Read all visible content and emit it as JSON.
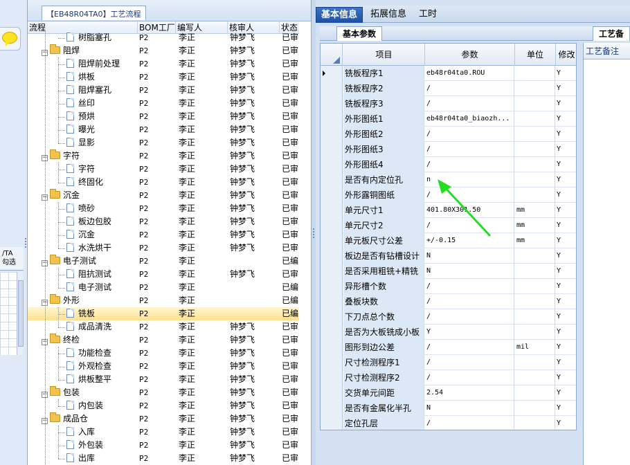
{
  "tree_panel": {
    "title": "【EB48R04TA0】工艺流程",
    "columns": [
      "流程",
      "BOM工厂",
      "编写人",
      "核审人",
      "状态"
    ],
    "rows": [
      {
        "type": "leaf",
        "name": "树脂塞孔",
        "bom": "P2",
        "writer": "李正",
        "reviewer": "钟梦飞",
        "status": "已审"
      },
      {
        "type": "group",
        "name": "阻焊",
        "bom": "P2",
        "writer": "李正",
        "reviewer": "钟梦飞",
        "status": "已审"
      },
      {
        "type": "leaf",
        "name": "阻焊前处理",
        "bom": "P2",
        "writer": "李正",
        "reviewer": "钟梦飞",
        "status": "已审"
      },
      {
        "type": "leaf",
        "name": "烘板",
        "bom": "P2",
        "writer": "李正",
        "reviewer": "钟梦飞",
        "status": "已审"
      },
      {
        "type": "leaf",
        "name": "阻焊塞孔",
        "bom": "P2",
        "writer": "李正",
        "reviewer": "钟梦飞",
        "status": "已审"
      },
      {
        "type": "leaf",
        "name": "丝印",
        "bom": "P2",
        "writer": "李正",
        "reviewer": "钟梦飞",
        "status": "已审"
      },
      {
        "type": "leaf",
        "name": "预烘",
        "bom": "P2",
        "writer": "李正",
        "reviewer": "钟梦飞",
        "status": "已审"
      },
      {
        "type": "leaf",
        "name": "曝光",
        "bom": "P2",
        "writer": "李正",
        "reviewer": "钟梦飞",
        "status": "已审"
      },
      {
        "type": "leaf",
        "name": "显影",
        "bom": "P2",
        "writer": "李正",
        "reviewer": "钟梦飞",
        "status": "已审"
      },
      {
        "type": "group",
        "name": "字符",
        "bom": "P2",
        "writer": "李正",
        "reviewer": "钟梦飞",
        "status": "已审"
      },
      {
        "type": "leaf",
        "name": "字符",
        "bom": "P2",
        "writer": "李正",
        "reviewer": "钟梦飞",
        "status": "已审"
      },
      {
        "type": "leaf",
        "name": "终固化",
        "bom": "P2",
        "writer": "李正",
        "reviewer": "钟梦飞",
        "status": "已审"
      },
      {
        "type": "group",
        "name": "沉金",
        "bom": "P2",
        "writer": "李正",
        "reviewer": "钟梦飞",
        "status": "已审"
      },
      {
        "type": "leaf",
        "name": "喷砂",
        "bom": "P2",
        "writer": "李正",
        "reviewer": "钟梦飞",
        "status": "已审"
      },
      {
        "type": "leaf",
        "name": "板边包胶",
        "bom": "P2",
        "writer": "李正",
        "reviewer": "钟梦飞",
        "status": "已审"
      },
      {
        "type": "leaf",
        "name": "沉金",
        "bom": "P2",
        "writer": "李正",
        "reviewer": "钟梦飞",
        "status": "已审"
      },
      {
        "type": "leaf",
        "name": "水洗烘干",
        "bom": "P2",
        "writer": "李正",
        "reviewer": "钟梦飞",
        "status": "已审"
      },
      {
        "type": "group",
        "name": "电子测试",
        "bom": "P2",
        "writer": "李正",
        "reviewer": "",
        "status": "已编"
      },
      {
        "type": "leaf",
        "name": "阻抗测试",
        "bom": "P2",
        "writer": "李正",
        "reviewer": "钟梦飞",
        "status": "已审"
      },
      {
        "type": "leaf",
        "name": "电子测试",
        "bom": "P2",
        "writer": "李正",
        "reviewer": "",
        "status": "已编"
      },
      {
        "type": "group",
        "name": "外形",
        "bom": "P2",
        "writer": "李正",
        "reviewer": "",
        "status": "已编"
      },
      {
        "type": "leaf",
        "name": "铣板",
        "bom": "P2",
        "writer": "李正",
        "reviewer": "",
        "status": "已编",
        "selected": true
      },
      {
        "type": "leaf",
        "name": "成品清洗",
        "bom": "P2",
        "writer": "李正",
        "reviewer": "钟梦飞",
        "status": "已审"
      },
      {
        "type": "group",
        "name": "终检",
        "bom": "P2",
        "writer": "李正",
        "reviewer": "钟梦飞",
        "status": "已审"
      },
      {
        "type": "leaf",
        "name": "功能检查",
        "bom": "P2",
        "writer": "李正",
        "reviewer": "钟梦飞",
        "status": "已审"
      },
      {
        "type": "leaf",
        "name": "外观检查",
        "bom": "P2",
        "writer": "李正",
        "reviewer": "钟梦飞",
        "status": "已审"
      },
      {
        "type": "leaf",
        "name": "烘板整平",
        "bom": "P2",
        "writer": "李正",
        "reviewer": "钟梦飞",
        "status": "已审"
      },
      {
        "type": "group",
        "name": "包装",
        "bom": "P2",
        "writer": "李正",
        "reviewer": "钟梦飞",
        "status": "已审"
      },
      {
        "type": "leaf",
        "name": "内包装",
        "bom": "P2",
        "writer": "李正",
        "reviewer": "钟梦飞",
        "status": "已审"
      },
      {
        "type": "group",
        "name": "成品仓",
        "bom": "P2",
        "writer": "李正",
        "reviewer": "钟梦飞",
        "status": "已审"
      },
      {
        "type": "leaf",
        "name": "入库",
        "bom": "P2",
        "writer": "李正",
        "reviewer": "钟梦飞",
        "status": "已审"
      },
      {
        "type": "leaf",
        "name": "外包装",
        "bom": "P2",
        "writer": "李正",
        "reviewer": "钟梦飞",
        "status": "已审"
      },
      {
        "type": "leaf",
        "name": "出库",
        "bom": "P2",
        "writer": "李正",
        "reviewer": "钟梦飞",
        "status": "已审"
      }
    ]
  },
  "left_strip": {
    "label_top": "/TA",
    "label_bottom": "勾选"
  },
  "right_panel": {
    "tabs": [
      "基本信息",
      "拓展信息",
      "工时"
    ],
    "active_tab": "基本信息",
    "sub_tab": "基本参数",
    "side_tab": "工艺备",
    "side_header": "工艺备注",
    "grid_columns": [
      "项目",
      "参数",
      "单位",
      "修改"
    ],
    "grid_rows": [
      {
        "item": "铣板程序1",
        "param": "eb48r04ta0.ROU",
        "unit": "",
        "mod": "Y"
      },
      {
        "item": "铣板程序2",
        "param": "/",
        "unit": "",
        "mod": "Y"
      },
      {
        "item": "铣板程序3",
        "param": "/",
        "unit": "",
        "mod": "Y"
      },
      {
        "item": "外形图纸1",
        "param": "eb48r04ta0_biaozh...",
        "unit": "",
        "mod": "Y"
      },
      {
        "item": "外形图纸2",
        "param": "/",
        "unit": "",
        "mod": "Y"
      },
      {
        "item": "外形图纸3",
        "param": "/",
        "unit": "",
        "mod": "Y"
      },
      {
        "item": "外形图纸4",
        "param": "/",
        "unit": "",
        "mod": "Y"
      },
      {
        "item": "是否有内定位孔",
        "param": "n",
        "unit": "",
        "mod": "Y"
      },
      {
        "item": "外形露铜图纸",
        "param": "/",
        "unit": "",
        "mod": "Y"
      },
      {
        "item": "单元尺寸1",
        "param": "401.80X301.50",
        "unit": "mm",
        "mod": "Y"
      },
      {
        "item": "单元尺寸2",
        "param": "/",
        "unit": "mm",
        "mod": "Y"
      },
      {
        "item": "单元板尺寸公差",
        "param": "+/-0.15",
        "unit": "mm",
        "mod": "Y"
      },
      {
        "item": "板边是否有钻槽设计",
        "param": "N",
        "unit": "",
        "mod": "Y"
      },
      {
        "item": "是否采用粗铣+精铣",
        "param": "N",
        "unit": "",
        "mod": "Y"
      },
      {
        "item": "异形槽个数",
        "param": "/",
        "unit": "",
        "mod": "Y"
      },
      {
        "item": "叠板块数",
        "param": "/",
        "unit": "",
        "mod": "Y"
      },
      {
        "item": "下刀点总个数",
        "param": "/",
        "unit": "",
        "mod": "Y"
      },
      {
        "item": "是否为大板铣成小板",
        "param": "Y",
        "unit": "",
        "mod": "Y"
      },
      {
        "item": "图形到边公差",
        "param": "/",
        "unit": "mil",
        "mod": "Y"
      },
      {
        "item": "尺寸检测程序1",
        "param": "/",
        "unit": "",
        "mod": "Y"
      },
      {
        "item": "尺寸检测程序2",
        "param": "/",
        "unit": "",
        "mod": "Y"
      },
      {
        "item": "交货单元间距",
        "param": "2.54",
        "unit": "",
        "mod": "Y"
      },
      {
        "item": "是否有金属化半孔",
        "param": "N",
        "unit": "",
        "mod": "Y"
      },
      {
        "item": "定位孔层",
        "param": "/",
        "unit": "",
        "mod": "Y"
      }
    ]
  },
  "annotation": {
    "arrow_color": "#22dd22",
    "target_row": "是否有内定位孔"
  },
  "colors": {
    "active_tab": "#1d4fa3",
    "selected_row": "#ffe08f",
    "folder": "#f3c24d"
  }
}
